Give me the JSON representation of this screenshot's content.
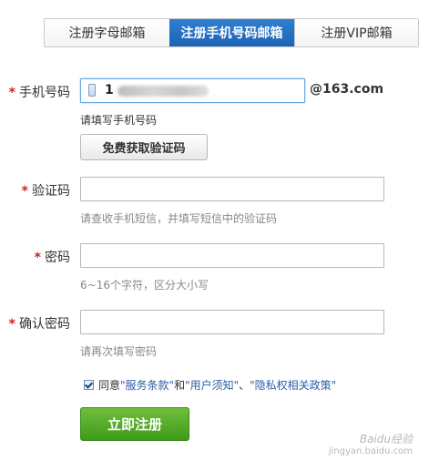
{
  "tabs": [
    {
      "label": "注册字母邮箱",
      "active": false
    },
    {
      "label": "注册手机号码邮箱",
      "active": true
    },
    {
      "label": "注册VIP邮箱",
      "active": false
    }
  ],
  "form": {
    "required_mark": "*",
    "phone": {
      "label": "手机号码",
      "value": "1",
      "domain": "@163.com",
      "hint": "请填写手机号码",
      "get_code_button": "免费获取验证码"
    },
    "code": {
      "label": "验证码",
      "hint": "请查收手机短信，并填写短信中的验证码"
    },
    "password": {
      "label": "密码",
      "hint": "6~16个字符，区分大小写"
    },
    "confirm": {
      "label": "确认密码",
      "hint": "请再次填写密码"
    },
    "agree": {
      "checked": true,
      "prefix": "同意",
      "link1": "\"服务条款\"",
      "and": "和",
      "link2": "\"用户须知\"",
      "sep": "、",
      "link3": "\"隐私权相关政策\""
    },
    "submit_button": "立即注册"
  },
  "watermark": {
    "line1": "Baidu经验",
    "line2": "jingyan.baidu.com"
  },
  "colors": {
    "tab_active": "#2368bb",
    "submit_green": "#4fa627",
    "required_red": "#d42020",
    "link_blue": "#2b5ea8"
  }
}
